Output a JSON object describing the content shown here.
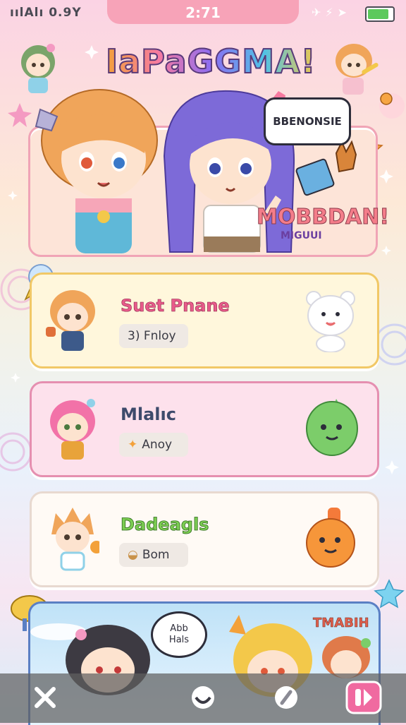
{
  "status_bar": {
    "left_text": "ıılAlı 0.9Y",
    "time": "2:71",
    "icons": [
      "airplane-icon",
      "signal-icon",
      "wifi-icon"
    ],
    "battery_level": 0.85
  },
  "app": {
    "title": "IaPaGGMA!"
  },
  "hero": {
    "speech_text": "BBENONSIE",
    "subtitle": "MOBBDAN!",
    "subtitle_small": "MIGUUI"
  },
  "cards": [
    {
      "name": "Suet Pnane",
      "chip": "3) Fnloy",
      "avatar": "orange-hair-avatar",
      "mascot": "white-bear-icon",
      "accent": "#f1c866"
    },
    {
      "name": "Mlalıc",
      "chip": "Anoy",
      "chip_icon": "sparkle-icon",
      "avatar": "pink-hair-avatar",
      "mascot": "green-ghost-icon",
      "accent": "#e58fb0"
    },
    {
      "name": "Dadeagls",
      "chip": "Bom",
      "chip_icon": "bread-icon",
      "avatar": "spiky-hair-avatar",
      "mascot": "orange-blob-icon",
      "accent": "#e8d9d0"
    }
  ],
  "banner": {
    "bubble_line1": "Abb",
    "bubble_line2": "Hals",
    "tag": "TMABIH"
  },
  "nav": [
    {
      "id": "tools",
      "icon": "wrench-cross-icon"
    },
    {
      "id": "home",
      "icon": "chat-bubble-icon"
    },
    {
      "id": "pen",
      "icon": "pen-nib-icon"
    },
    {
      "id": "play",
      "icon": "pink-play-icon"
    }
  ]
}
